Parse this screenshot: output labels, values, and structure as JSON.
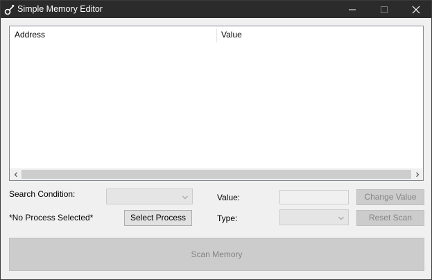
{
  "window": {
    "title": "Simple Memory Editor"
  },
  "listview": {
    "columns": [
      "Address",
      "Value"
    ],
    "rows": []
  },
  "controls": {
    "search_condition_label": "Search Condition:",
    "process_status": "*No Process Selected*",
    "select_process_label": "Select Process",
    "value_label": "Value:",
    "type_label": "Type:",
    "change_value_label": "Change Value",
    "reset_scan_label": "Reset Scan",
    "scan_memory_label": "Scan Memory"
  },
  "colors": {
    "titlebar": "#2b2b2b",
    "window_bg": "#f0f0f0",
    "disabled_button": "#cccccc",
    "disabled_text": "#838383"
  }
}
